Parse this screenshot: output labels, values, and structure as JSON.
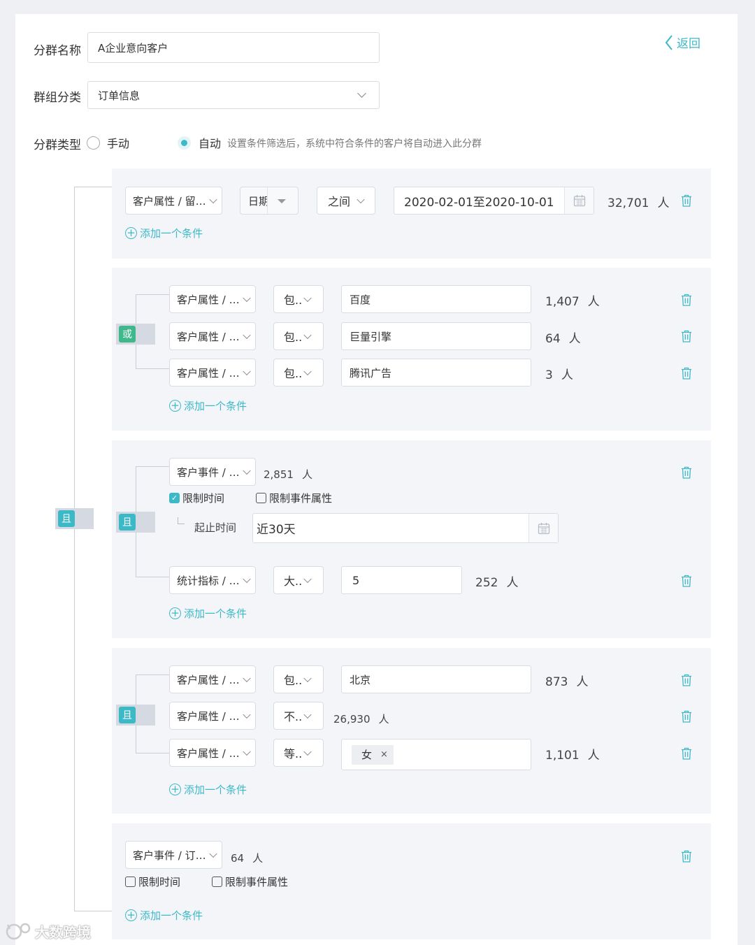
{
  "form": {
    "name_label": "分群名称",
    "name_value": "A企业意向客户",
    "category_label": "群组分类",
    "category_value": "订单信息",
    "type_label": "分群类型",
    "type_manual": "手动",
    "type_auto": "自动",
    "type_hint": "设置条件筛选后，系统中符合条件的客户将自动进入此分群",
    "back_label": "返回"
  },
  "common": {
    "person_unit": "人",
    "add_condition": "添加一个条件",
    "and": "且",
    "or": "或"
  },
  "group1": {
    "field": "客户属性 / 留…",
    "subtype": "日期",
    "operator": "之间",
    "date_range": "2020-02-01至2020-10-01",
    "count": "32,701"
  },
  "group2": {
    "rows": [
      {
        "field": "客户属性 / …",
        "op": "包..",
        "value": "百度",
        "count": "1,407"
      },
      {
        "field": "客户属性 / …",
        "op": "包..",
        "value": "巨量引擎",
        "count": "64"
      },
      {
        "field": "客户属性 / …",
        "op": "包..",
        "value": "腾讯广告",
        "count": "3"
      }
    ]
  },
  "group3": {
    "event_field": "客户事件 / …",
    "event_count": "2,851",
    "limit_time": "限制时间",
    "limit_attr": "限制事件属性",
    "start_end_label": "起止时间",
    "time_value": "近30天",
    "metric_field": "统计指标 / …",
    "metric_op": "大..",
    "metric_value": "5",
    "metric_count": "252"
  },
  "group4": {
    "rows": [
      {
        "field": "客户属性 / …",
        "op": "包..",
        "value": "北京",
        "count": "873"
      },
      {
        "field": "客户属性 / …",
        "op": "不..",
        "count": "26,930"
      },
      {
        "field": "客户属性 / …",
        "op": "等..",
        "chip": "女",
        "chip_close": "×",
        "count": "1,101"
      }
    ]
  },
  "group5": {
    "event_field": "客户事件 / 订…",
    "count": "64",
    "limit_time": "限制时间",
    "limit_attr": "限制事件属性"
  },
  "watermark": "大数跨境",
  "colors": {
    "accent": "#3cb9c7",
    "or_tag": "#3fb98c",
    "panel": "#f4f5f9"
  }
}
